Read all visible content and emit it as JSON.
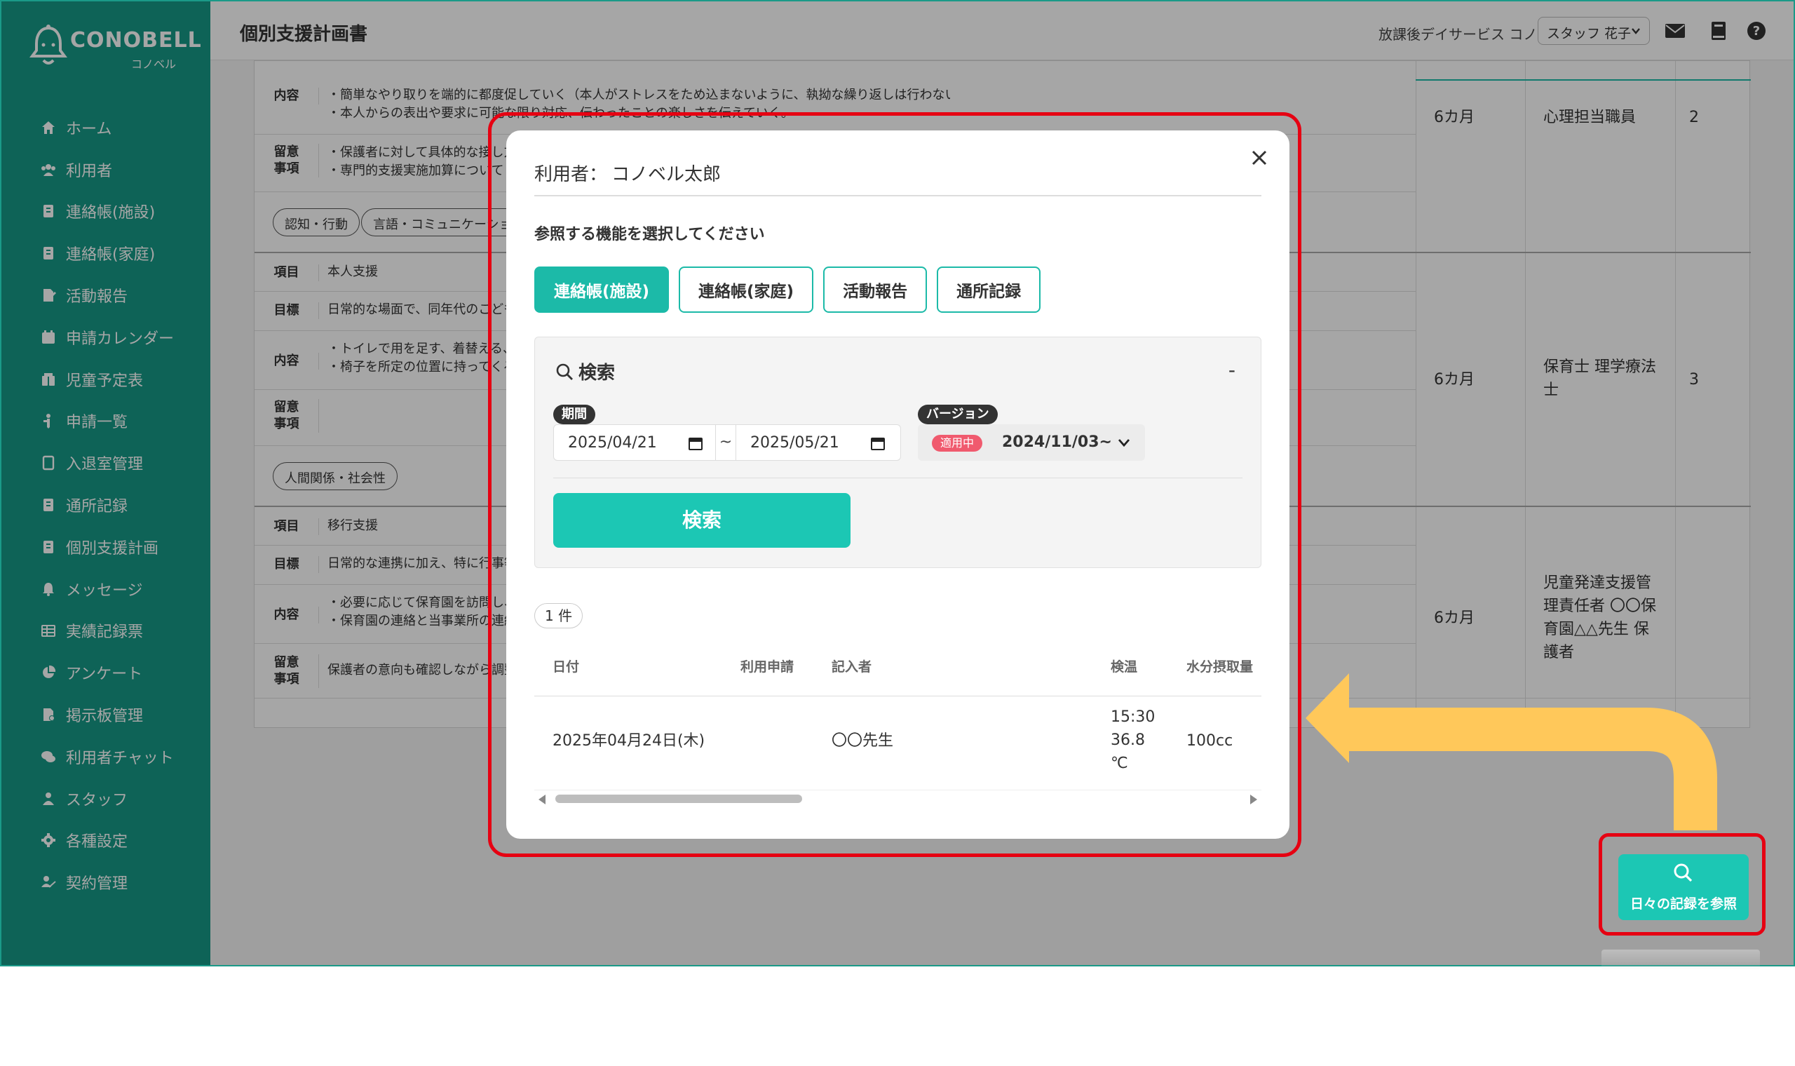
{
  "brand": {
    "name": "CONOBELL",
    "sub": "コノベル"
  },
  "header": {
    "title": "個別支援計画書",
    "facility": "放課後デイサービス コノベル",
    "staff": "スタッフ 花子"
  },
  "sidebar": {
    "items": [
      {
        "label": "ホーム",
        "icon": "home-icon"
      },
      {
        "label": "利用者",
        "icon": "users-icon"
      },
      {
        "label": "連絡帳(施設)",
        "icon": "notebook-icon"
      },
      {
        "label": "連絡帳(家庭)",
        "icon": "notebook-icon"
      },
      {
        "label": "活動報告",
        "icon": "report-icon"
      },
      {
        "label": "申請カレンダー",
        "icon": "calendar-icon"
      },
      {
        "label": "児童予定表",
        "icon": "schedule-icon"
      },
      {
        "label": "申請一覧",
        "icon": "list-icon"
      },
      {
        "label": "入退室管理",
        "icon": "door-icon"
      },
      {
        "label": "通所記録",
        "icon": "record-icon"
      },
      {
        "label": "個別支援計画",
        "icon": "plan-icon"
      },
      {
        "label": "メッセージ",
        "icon": "bell-icon"
      },
      {
        "label": "実績記録票",
        "icon": "table-icon"
      },
      {
        "label": "アンケート",
        "icon": "pie-icon"
      },
      {
        "label": "掲示板管理",
        "icon": "board-icon"
      },
      {
        "label": "利用者チャット",
        "icon": "chat-icon"
      },
      {
        "label": "スタッフ",
        "icon": "staff-icon"
      },
      {
        "label": "各種設定",
        "icon": "gear-icon"
      },
      {
        "label": "契約管理",
        "icon": "contract-icon"
      }
    ]
  },
  "background": {
    "group1": {
      "content_label": "内容",
      "content_1": "・簡単なやり取りを端的に都度促していく（本人がストレスをため込まないように、執拗な繰り返しは行わない）。",
      "content_2": "・本人からの表出や要求に可能な限り対応、伝わったことの楽しさを伝えていく。",
      "note_label_1": "留意",
      "note_label_2": "事項",
      "note_1": "・保護者に対して具体的な接し方",
      "note_2": "・専門的支援実施加算について",
      "tag_1": "認知・行動",
      "tag_2": "言語・コミュニケーション",
      "period": "6カ月",
      "staff": "心理担当職員",
      "priority": "2"
    },
    "group2": {
      "item_label": "項目",
      "item": "本人支援",
      "goal_label": "目標",
      "goal": "日常的な場面で、同年代のこども",
      "content_label": "内容",
      "content_1": "・トイレで用を足す、着替える、食事",
      "content_2": "・椅子を所定の位置に持ってくる場",
      "note_label_1": "留意",
      "note_label_2": "事項",
      "tag": "人間関係・社会性",
      "period": "6カ月",
      "staff_1": "保育士 理学療法",
      "staff_2": "士",
      "priority": "3"
    },
    "group3": {
      "item_label": "項目",
      "item": "移行支援",
      "goal_label": "目標",
      "goal": "日常的な連携に加え、特に行事等",
      "content_label": "内容",
      "content_1": "・必要に応じて保育園を訪問し、行",
      "content_2": "・保育園の連絡と当事業所の連絡",
      "note_label_1": "留意",
      "note_label_2": "事項",
      "note": "保護者の意向も確認しながら調整",
      "period": "6カ月",
      "staff_1": "児童発達支援管",
      "staff_2": "理責任者 〇〇保",
      "staff_3": "育園△△先生 保",
      "staff_4": "護者"
    }
  },
  "modal": {
    "user_label": "利用者：",
    "user_name": "コノベル太郎",
    "prompt": "参照する機能を選択してください",
    "tabs": [
      "連絡帳(施設)",
      "連絡帳(家庭)",
      "活動報告",
      "通所記録"
    ],
    "search": {
      "title": "検索",
      "collapse": "-",
      "period_label": "期間",
      "date_from": "2025/04/21",
      "date_to": "2025/05/21",
      "separator": "~",
      "version_label": "バージョン",
      "applied_badge": "適用中",
      "version_value": "2024/11/03~",
      "button": "検索"
    },
    "result_count": "1 件",
    "table": {
      "headers": [
        "日付",
        "利用申請",
        "記入者",
        "検温",
        "水分摂取量"
      ],
      "row": {
        "date": "2025年04月24日(木)",
        "writer": "〇〇先生",
        "temp_time": "15:30",
        "temp_value": "36.8",
        "temp_unit": "℃",
        "water": "100cc"
      }
    }
  },
  "floating_button": {
    "label": "日々の記録を参照"
  },
  "colors": {
    "brand": "#169886",
    "accent": "#1cc7b4",
    "highlight": "#e60012",
    "arrow": "#ffc85a"
  }
}
